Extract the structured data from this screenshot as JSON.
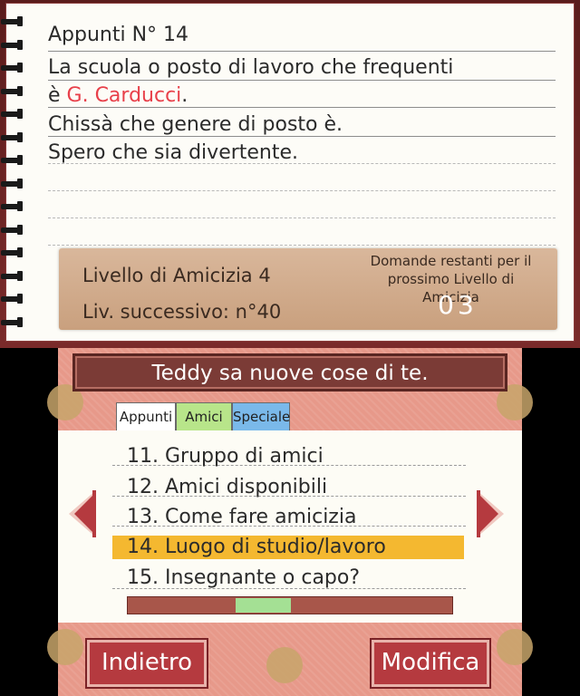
{
  "notebook": {
    "title": "Appunti N° 14",
    "line1": "La scuola o posto di lavoro che frequenti",
    "line2_prefix": "è ",
    "line2_highlight": "G. Carducci",
    "line2_suffix": ".",
    "line3": "Chissà che genere di posto è.",
    "line4": "Spero che sia divertente."
  },
  "friendship": {
    "level_label": "Livello di Amicizia 4",
    "next_label": "Liv. successivo: n°40",
    "remaining_label": "Domande restanti per il prossimo Livello di Amicizia",
    "remaining_count": "03"
  },
  "banner": {
    "text": "Teddy sa nuove cose di te."
  },
  "tabs": [
    {
      "label": "Appunti",
      "active": true
    },
    {
      "label": "Amici",
      "active": false
    },
    {
      "label": "Speciale",
      "active": false
    }
  ],
  "items": [
    {
      "label": "11. Gruppo di amici"
    },
    {
      "label": "12. Amici disponibili"
    },
    {
      "label": "13. Come fare amicizia"
    },
    {
      "label": "14. Luogo di studio/lavoro",
      "selected": true
    },
    {
      "label": "15. Insegnante o capo?"
    }
  ],
  "scroll": {
    "position": 0.4,
    "thumb_size": 0.17
  },
  "buttons": {
    "back": "Indietro",
    "edit": "Modifica"
  },
  "colors": {
    "highlight_text": "#e8404a",
    "selected_row": "#f4b830",
    "button": "#b53a3f"
  }
}
